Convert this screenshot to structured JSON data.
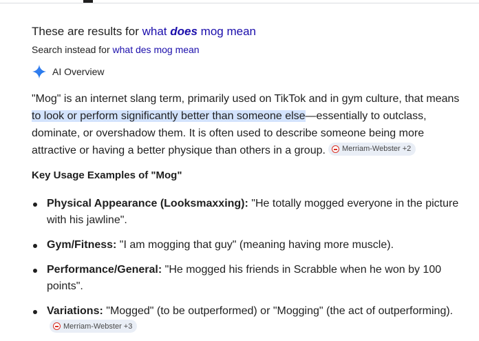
{
  "spelling": {
    "prefix": "These are results for ",
    "corrected_pre": "what ",
    "corrected_bold": "does",
    "corrected_post": " mog mean",
    "instead_prefix": "Search instead for ",
    "instead_query": "what des mog mean"
  },
  "ai_overview": {
    "label": "AI Overview",
    "icon": "sparkle-icon",
    "accent_color": "#4285f4"
  },
  "paragraph": {
    "before": "\"Mog\" is an internet slang term, primarily used on TikTok and in gym culture, that means ",
    "highlighted": "to look or perform significantly better than someone else",
    "after": "—essentially to outclass, dominate, or overshadow them. It is often used to describe someone being more attractive or having a better physique than others in a group.",
    "source": "Merriam-Webster +2"
  },
  "key_heading": "Key Usage Examples of \"Mog\"",
  "bullets": [
    {
      "term": "Physical Appearance (Looksmaxxing):",
      "text": " \"He totally mogged everyone in the picture with his jawline\"."
    },
    {
      "term": "Gym/Fitness:",
      "text": " \"I am mogging that guy\" (meaning having more muscle)."
    },
    {
      "term": "Performance/General:",
      "text": " \"He mogged his friends in Scrabble when he won by 100 points\"."
    },
    {
      "term": "Variations:",
      "text": " \"Mogged\" (to be outperformed) or \"Mogging\" (the act of outperforming).",
      "source": "Merriam-Webster +3"
    }
  ],
  "colors": {
    "link": "#1a0dab",
    "highlight": "#d3e3fd",
    "chip_bg": "#e9eef6"
  }
}
